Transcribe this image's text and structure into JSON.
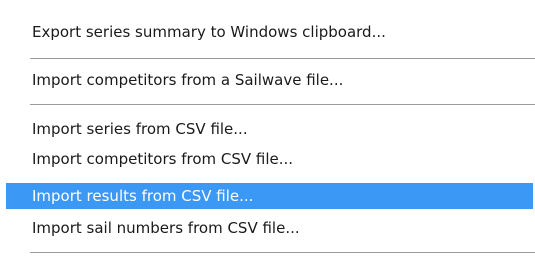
{
  "menu": {
    "items": [
      {
        "label": "Export series summary to Windows clipboard..."
      },
      {
        "label": "Import competitors from a Sailwave file..."
      },
      {
        "label": "Import series from CSV file..."
      },
      {
        "label": "Import competitors from CSV file..."
      },
      {
        "label": "Import results from CSV file...",
        "highlighted": true
      },
      {
        "label": "Import sail numbers from CSV file..."
      }
    ]
  },
  "colors": {
    "highlight_background": "#3b99f5",
    "highlight_text": "#ffffff",
    "separator": "#9a9a9a",
    "text": "#1a1a1a"
  }
}
